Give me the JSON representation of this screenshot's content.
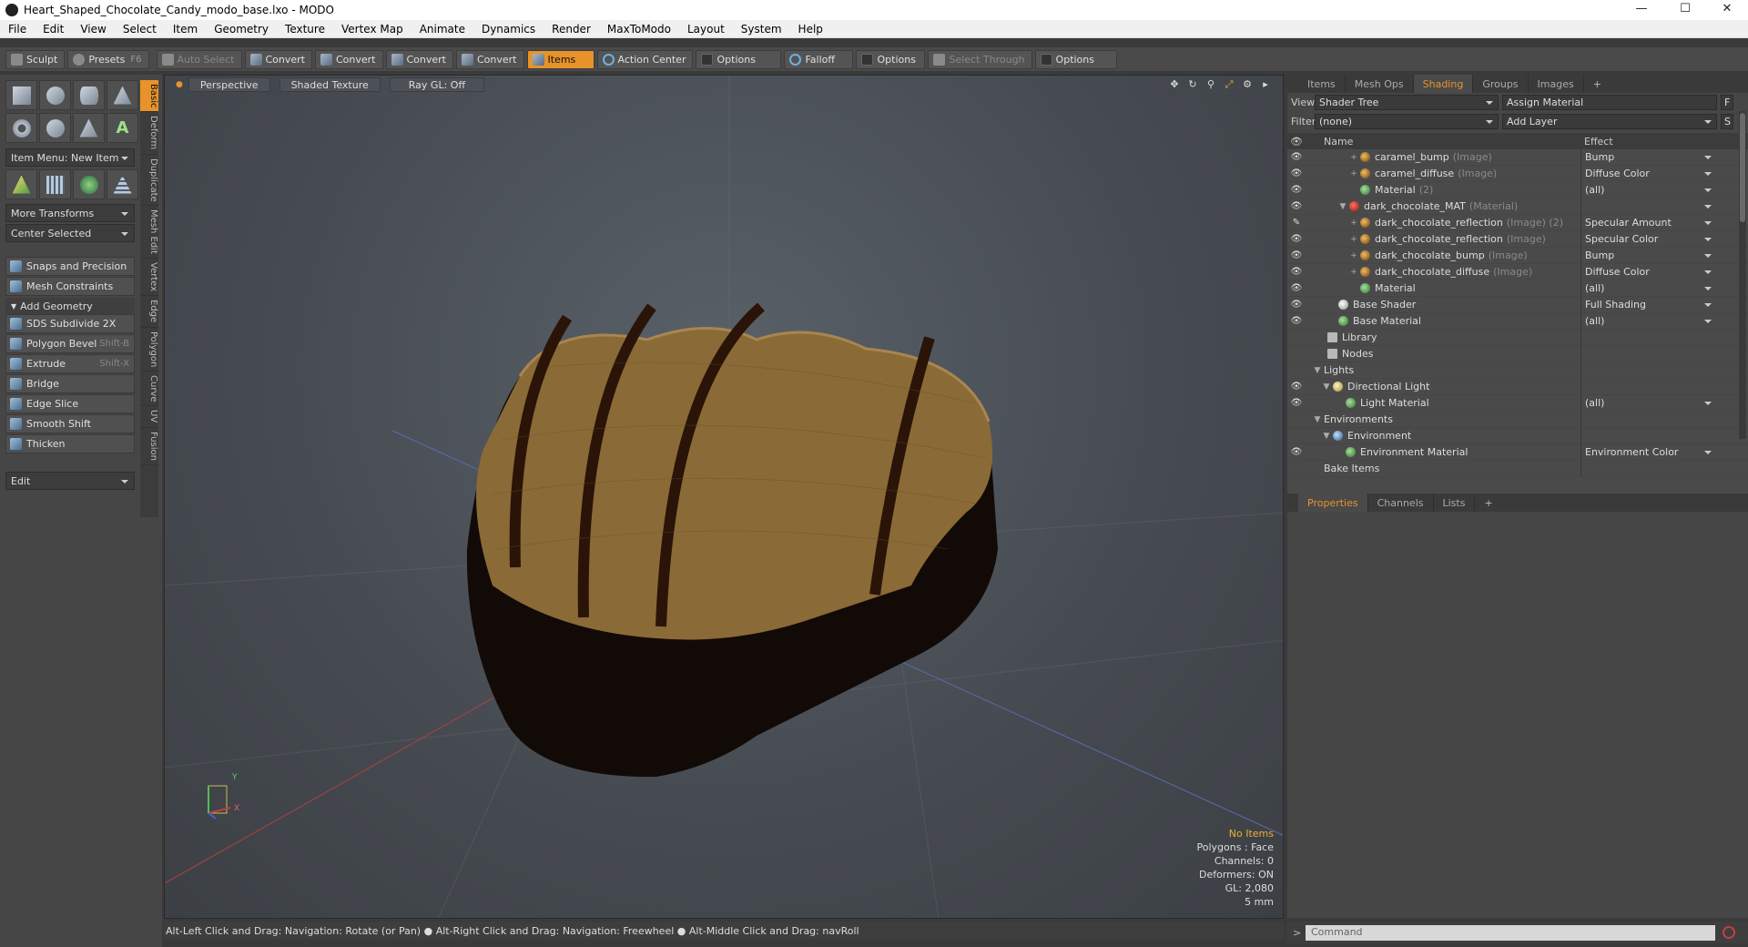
{
  "window": {
    "title": "Heart_Shaped_Chocolate_Candy_modo_base.lxo - MODO",
    "minimize": "—",
    "maximize": "☐",
    "close": "✕"
  },
  "menu": [
    "File",
    "Edit",
    "View",
    "Select",
    "Item",
    "Geometry",
    "Texture",
    "Vertex Map",
    "Animate",
    "Dynamics",
    "Render",
    "MaxToModo",
    "Layout",
    "System",
    "Help"
  ],
  "toolbar": {
    "sculpt": "Sculpt",
    "presets": "Presets",
    "presets_key": "F6",
    "auto_select": "Auto Select",
    "convert1": "Convert",
    "convert2": "Convert",
    "convert3": "Convert",
    "convert4": "Convert",
    "items": "Items",
    "action_center": "Action Center",
    "options1": "Options",
    "falloff": "Falloff",
    "options2": "Options",
    "select_through": "Select Through",
    "options3": "Options"
  },
  "left": {
    "item_menu": "Item Menu: New Item",
    "more_transforms": "More Transforms",
    "center_selected": "Center Selected",
    "snaps": "Snaps and Precision",
    "constraints": "Mesh Constraints",
    "add_geometry": "Add Geometry",
    "tools": [
      {
        "label": "SDS Subdivide 2X",
        "shortcut": ""
      },
      {
        "label": "Polygon Bevel",
        "shortcut": "Shift-B"
      },
      {
        "label": "Extrude",
        "shortcut": "Shift-X"
      },
      {
        "label": "Bridge",
        "shortcut": ""
      },
      {
        "label": "Edge Slice",
        "shortcut": ""
      },
      {
        "label": "Smooth Shift",
        "shortcut": ""
      },
      {
        "label": "Thicken",
        "shortcut": ""
      }
    ],
    "edit": "Edit",
    "vtabs": [
      "Basic",
      "Deform",
      "Duplicate",
      "Mesh Edit",
      "Vertex",
      "Edge",
      "Polygon",
      "Curve",
      "UV",
      "Fusion"
    ]
  },
  "viewport": {
    "perspective": "Perspective",
    "shading": "Shaded Texture",
    "raygl": "Ray GL: Off",
    "stats": {
      "selection": "No Items",
      "polygons": "Polygons : Face",
      "channels": "Channels: 0",
      "deformers": "Deformers: ON",
      "gl": "GL: 2,080",
      "scale": "5 mm"
    },
    "axis_x": "X",
    "axis_y": "Y"
  },
  "status": "Alt-Left Click and Drag: Navigation: Rotate (or Pan) ● Alt-Right Click and Drag: Navigation: Freewheel ● Alt-Middle Click and Drag: navRoll",
  "shading": {
    "tabs": [
      "Items",
      "Mesh Ops",
      "Shading",
      "Groups",
      "Images",
      "+"
    ],
    "view_label": "View",
    "view_value": "Shader Tree",
    "assign": "Assign Material",
    "f_btn": "F",
    "filter_label": "Filter",
    "filter_value": "(none)",
    "add_layer": "Add Layer",
    "s_btn": "S",
    "col_name": "Name",
    "col_effect": "Effect",
    "rows": [
      {
        "name": "caramel_bump",
        "type": "(Image)",
        "effect": "Bump",
        "icon": "img",
        "indent": 40,
        "eye": "👁",
        "tw": "+"
      },
      {
        "name": "caramel_diffuse",
        "type": "(Image)",
        "effect": "Diffuse Color",
        "icon": "img",
        "indent": 40,
        "eye": "👁",
        "tw": "+"
      },
      {
        "name": "Material",
        "type": "(2)",
        "effect": "(all)",
        "icon": "mat",
        "indent": 40,
        "eye": "👁",
        "tw": ""
      },
      {
        "name": "dark_chocolate_MAT",
        "type": "(Material)",
        "effect": "",
        "icon": "red",
        "indent": 28,
        "eye": "👁",
        "tw": "▼"
      },
      {
        "name": "dark_chocolate_reflection",
        "type": "(Image) (2)",
        "effect": "Specular Amount",
        "icon": "img",
        "indent": 40,
        "eye": "✎",
        "tw": "+"
      },
      {
        "name": "dark_chocolate_reflection",
        "type": "(Image)",
        "effect": "Specular Color",
        "icon": "img",
        "indent": 40,
        "eye": "👁",
        "tw": "+"
      },
      {
        "name": "dark_chocolate_bump",
        "type": "(Image)",
        "effect": "Bump",
        "icon": "img",
        "indent": 40,
        "eye": "👁",
        "tw": "+"
      },
      {
        "name": "dark_chocolate_diffuse",
        "type": "(Image)",
        "effect": "Diffuse Color",
        "icon": "img",
        "indent": 40,
        "eye": "👁",
        "tw": "+"
      },
      {
        "name": "Material",
        "type": "",
        "effect": "(all)",
        "icon": "mat",
        "indent": 40,
        "eye": "👁",
        "tw": ""
      },
      {
        "name": "Base Shader",
        "type": "",
        "effect": "Full Shading",
        "icon": "shd",
        "indent": 16,
        "eye": "👁",
        "tw": ""
      },
      {
        "name": "Base Material",
        "type": "",
        "effect": "(all)",
        "icon": "mat",
        "indent": 16,
        "eye": "👁",
        "tw": ""
      },
      {
        "name": "Library",
        "type": "",
        "effect": "",
        "icon": "fld",
        "indent": 4,
        "eye": "",
        "tw": ""
      },
      {
        "name": "Nodes",
        "type": "",
        "effect": "",
        "icon": "fld",
        "indent": 4,
        "eye": "",
        "tw": ""
      },
      {
        "name": "Lights",
        "type": "",
        "effect": "",
        "icon": "",
        "indent": 0,
        "eye": "",
        "tw": "▼"
      },
      {
        "name": "Directional Light",
        "type": "",
        "effect": "",
        "icon": "lit",
        "indent": 10,
        "eye": "👁",
        "tw": "▼"
      },
      {
        "name": "Light Material",
        "type": "",
        "effect": "(all)",
        "icon": "mat",
        "indent": 24,
        "eye": "👁",
        "tw": ""
      },
      {
        "name": "Environments",
        "type": "",
        "effect": "",
        "icon": "",
        "indent": 0,
        "eye": "",
        "tw": "▼"
      },
      {
        "name": "Environment",
        "type": "",
        "effect": "",
        "icon": "env",
        "indent": 10,
        "eye": "",
        "tw": "▼"
      },
      {
        "name": "Environment Material",
        "type": "",
        "effect": "Environment Color",
        "icon": "mat",
        "indent": 24,
        "eye": "👁",
        "tw": ""
      },
      {
        "name": "Bake Items",
        "type": "",
        "effect": "",
        "icon": "",
        "indent": 0,
        "eye": "",
        "tw": ""
      }
    ]
  },
  "props": {
    "tabs": [
      "Properties",
      "Channels",
      "Lists",
      "+"
    ]
  },
  "command": {
    "placeholder": "Command",
    "prompt": ">"
  }
}
